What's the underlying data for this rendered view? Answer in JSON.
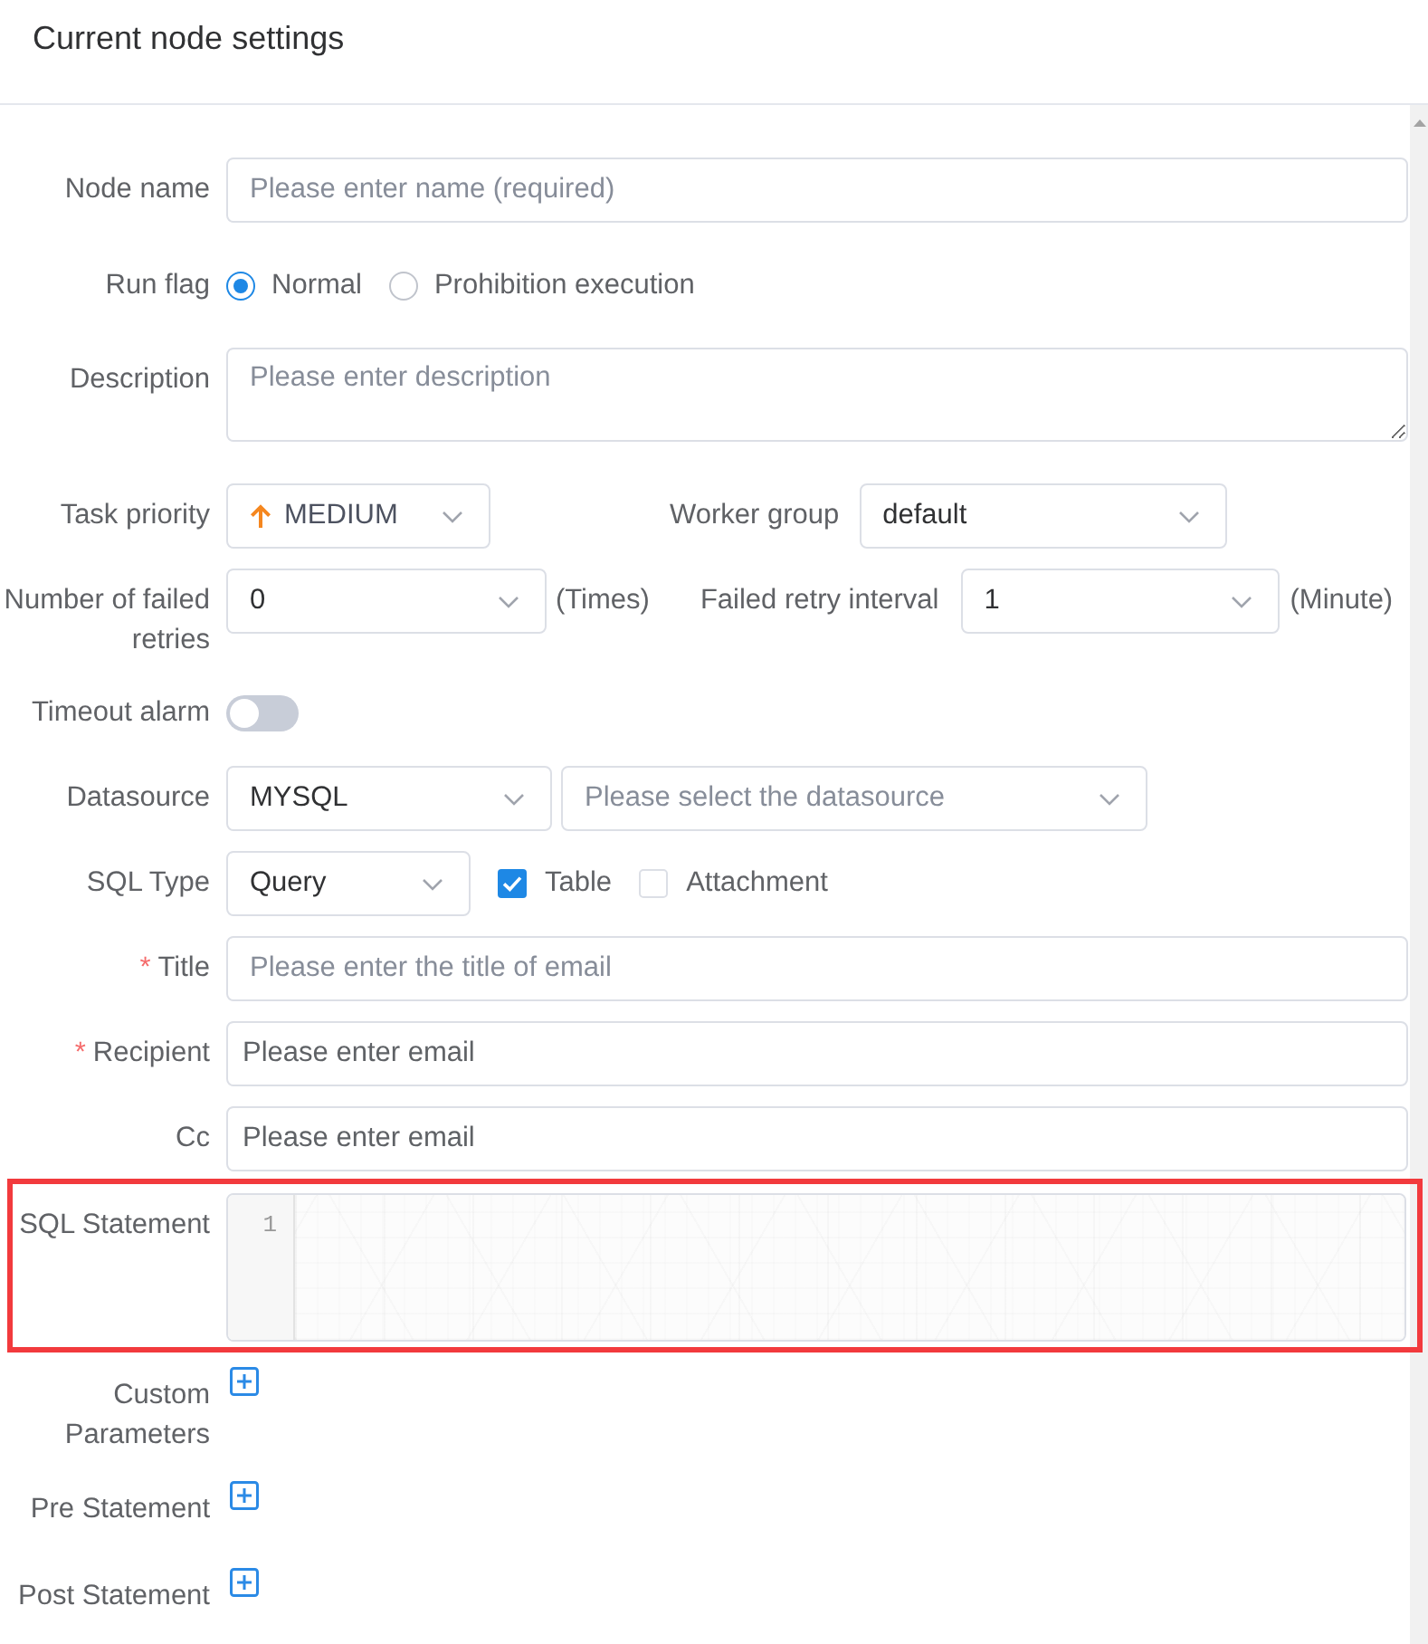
{
  "header": {
    "title": "Current node settings"
  },
  "rows": [
    {
      "label": "Node name",
      "controls": [
        {
          "kind": "input",
          "placeholder": "Please enter name (required)"
        }
      ]
    },
    {
      "label": "Run flag",
      "controls": [
        {
          "kind": "radio",
          "options": [
            {
              "label": "Normal",
              "selected": true
            },
            {
              "label": "Prohibition execution",
              "selected": false
            }
          ]
        }
      ]
    },
    {
      "label": "Description",
      "controls": [
        {
          "kind": "textarea",
          "placeholder": "Please enter description"
        }
      ]
    },
    {
      "label": "Task priority",
      "controls": [
        {
          "kind": "priority",
          "value": "MEDIUM"
        },
        {
          "kind": "label",
          "text": "Worker group"
        },
        {
          "kind": "select",
          "value": "default"
        }
      ]
    },
    {
      "label": "Number of failed retries",
      "controls": [
        {
          "kind": "select",
          "value": "0"
        },
        {
          "kind": "unit",
          "text": "(Times)"
        },
        {
          "kind": "label",
          "text": "Failed retry interval"
        },
        {
          "kind": "select",
          "value": "1"
        },
        {
          "kind": "unit",
          "text": "(Minute)"
        }
      ]
    },
    {
      "label": "Timeout alarm",
      "controls": [
        {
          "kind": "switch",
          "on": false
        }
      ]
    },
    {
      "label": "Datasource",
      "controls": [
        {
          "kind": "select",
          "value": "MYSQL"
        },
        {
          "kind": "select",
          "placeholder": "Please select the datasource"
        }
      ]
    },
    {
      "label": "SQL Type",
      "controls": [
        {
          "kind": "select",
          "value": "Query"
        },
        {
          "kind": "checkbox",
          "label": "Table",
          "checked": true
        },
        {
          "kind": "checkbox",
          "label": "Attachment",
          "checked": false
        }
      ]
    },
    {
      "label": "Title",
      "mark": "*",
      "controls": [
        {
          "kind": "input",
          "placeholder": "Please enter the title of email"
        }
      ]
    },
    {
      "label": "Recipient",
      "mark": "*",
      "controls": [
        {
          "kind": "email",
          "placeholder": "Please enter email"
        }
      ]
    },
    {
      "label": "Cc",
      "controls": [
        {
          "kind": "email",
          "placeholder": "Please enter email"
        }
      ]
    },
    {
      "label": "SQL Statement",
      "highlighted": true,
      "controls": [
        {
          "kind": "editor",
          "line_numbers": [
            "1"
          ]
        }
      ]
    },
    {
      "label": "Custom Parameters",
      "controls": [
        {
          "kind": "add"
        }
      ]
    },
    {
      "label": "Pre Statement",
      "controls": [
        {
          "kind": "add"
        }
      ]
    },
    {
      "label": "Post Statement",
      "controls": [
        {
          "kind": "add"
        }
      ]
    }
  ]
}
